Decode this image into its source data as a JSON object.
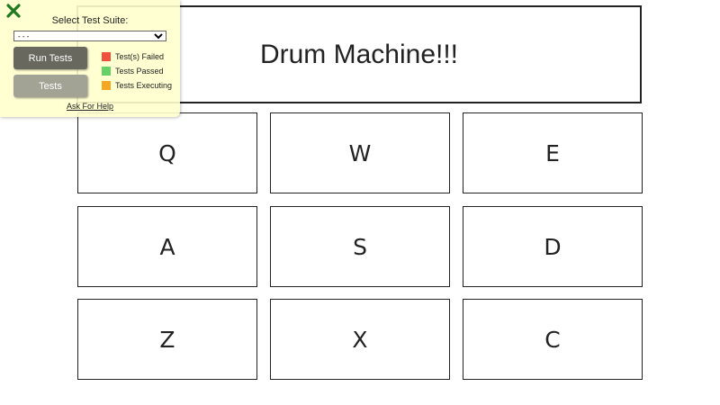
{
  "display": {
    "text": "Drum Machine!!!"
  },
  "pads": [
    "Q",
    "W",
    "E",
    "A",
    "S",
    "D",
    "Z",
    "X",
    "C"
  ],
  "test_panel": {
    "close_icon": "close-x-icon",
    "close_color": "#1f7a1f",
    "title": "Select Test Suite:",
    "select_value": "- - -",
    "run_button": "Run Tests",
    "tests_button": "Tests",
    "legend": [
      {
        "label": "Test(s) Failed",
        "color": "#f0503c"
      },
      {
        "label": "Tests Passed",
        "color": "#66d166"
      },
      {
        "label": "Tests Executing",
        "color": "#f5a623"
      }
    ],
    "help_link": "Ask For Help"
  }
}
